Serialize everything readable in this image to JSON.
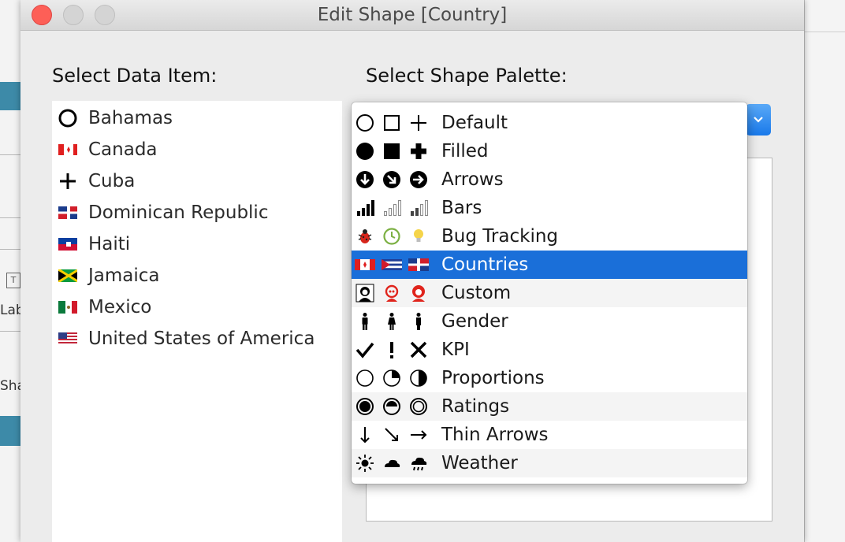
{
  "window": {
    "title": "Edit Shape [Country]"
  },
  "background_app": {
    "left_labels": [
      "Lab",
      "Sha"
    ],
    "left_box": "T"
  },
  "data_item_panel": {
    "label": "Select Data Item:",
    "items": [
      {
        "label": "Bahamas",
        "shape": "circle-outline-icon"
      },
      {
        "label": "Canada",
        "shape": "canada-flag-icon"
      },
      {
        "label": "Cuba",
        "shape": "plus-icon"
      },
      {
        "label": "Dominican Republic",
        "shape": "dominican-republic-flag-icon"
      },
      {
        "label": "Haiti",
        "shape": "haiti-flag-icon"
      },
      {
        "label": "Jamaica",
        "shape": "jamaica-flag-icon"
      },
      {
        "label": "Mexico",
        "shape": "mexico-flag-icon"
      },
      {
        "label": "United States of America",
        "shape": "usa-flag-icon"
      }
    ]
  },
  "shape_palette": {
    "label": "Select Shape Palette:",
    "selected": "Countries",
    "options": [
      {
        "label": "Default",
        "icons": [
          "circle-outline-icon",
          "square-outline-icon",
          "plus-icon"
        ]
      },
      {
        "label": "Filled",
        "icons": [
          "filled-circle-icon",
          "filled-square-icon",
          "filled-plus-icon"
        ]
      },
      {
        "label": "Arrows",
        "icons": [
          "arrow-down-circle-icon",
          "arrow-down-right-circle-icon",
          "arrow-right-circle-icon"
        ]
      },
      {
        "label": "Bars",
        "icons": [
          "bars-full-icon",
          "bars-outline-icon",
          "bars-partial-icon"
        ]
      },
      {
        "label": "Bug Tracking",
        "icons": [
          "bug-icon",
          "clock-icon",
          "lightbulb-icon"
        ]
      },
      {
        "label": "Countries",
        "icons": [
          "canada-flag-icon",
          "cuba-flag-icon",
          "dominican-republic-flag-icon"
        ]
      },
      {
        "label": "Custom",
        "icons": [
          "portrait-black-icon",
          "portrait-red-icon",
          "portrait-red-solid-icon"
        ]
      },
      {
        "label": "Gender",
        "icons": [
          "person-male-icon",
          "person-female-icon",
          "person-neutral-icon"
        ]
      },
      {
        "label": "KPI",
        "icons": [
          "checkmark-icon",
          "exclamation-icon",
          "x-mark-icon"
        ]
      },
      {
        "label": "Proportions",
        "icons": [
          "circle-empty-icon",
          "circle-quarter-icon",
          "circle-half-icon"
        ]
      },
      {
        "label": "Ratings",
        "icons": [
          "rating-full-icon",
          "rating-half-icon",
          "rating-empty-icon"
        ]
      },
      {
        "label": "Thin Arrows",
        "icons": [
          "thin-arrow-down-icon",
          "thin-arrow-down-right-icon",
          "thin-arrow-right-icon"
        ]
      },
      {
        "label": "Weather",
        "icons": [
          "sun-icon",
          "cloud-icon",
          "rain-cloud-icon"
        ]
      }
    ]
  },
  "colors": {
    "selection": "#1a6fd9",
    "stepper": "#1979ea",
    "close": "#fd5f57"
  }
}
